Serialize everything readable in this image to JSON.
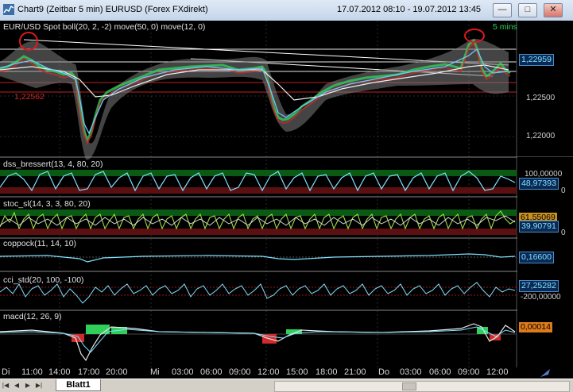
{
  "window": {
    "title": "Chart9 (Zeitbar 5 min)  EURUSD (Forex FXdirekt)",
    "date_range": "17.07.2012 08:10 - 19.07.2012 13:45",
    "minimize": "—",
    "maximize": "□",
    "close": "✕"
  },
  "main_panel": {
    "title": "EUR/USD Spot boll(20, 2, -2) move(50, 0) move(12, 0)",
    "timeframe": "5 mins",
    "scale": [
      "1,22500",
      "1,22000"
    ],
    "price_box": "1,22959",
    "line_label": "1,22562",
    "price_box_color": "#0a2a55"
  },
  "panels": [
    {
      "title": "dss_bressert(13, 4, 80, 20)",
      "scale_top": "100,00000",
      "scale_bottom": "0",
      "value": "48,97393"
    },
    {
      "title": "stoc_sl(14, 3, 3, 80, 20)",
      "scale_top": "0",
      "value": "39,90791",
      "value2": "61,55069"
    },
    {
      "title": "coppock(11, 14, 10)",
      "value": "0,16600"
    },
    {
      "title": "cci_std(20, 100, -100)",
      "scale_top": "27,25282",
      "scale_bottom": "-200,00000"
    },
    {
      "title": "macd(12, 26, 9)",
      "value": "0,00014"
    }
  ],
  "xaxis": [
    "Di",
    "11:00",
    "14:00",
    "17:00",
    "20:00",
    "Mi",
    "03:00",
    "06:00",
    "09:00",
    "12:00",
    "15:00",
    "18:00",
    "21:00",
    "Do",
    "03:00",
    "06:00",
    "09:00",
    "12:00"
  ],
  "statusbar": {
    "sheet_tab": "Blatt1",
    "nav": [
      "|◀",
      "◀",
      "▶",
      "▶|"
    ]
  },
  "colors": {
    "background": "#000000",
    "price_line": "#6ec8ff",
    "band": "#9a9a9a",
    "oscillator": "#7fe0ff",
    "overbought_zone": "#0a5a14",
    "oversold_zone": "#5a1010",
    "circle_annotation": "#e0181c"
  }
}
